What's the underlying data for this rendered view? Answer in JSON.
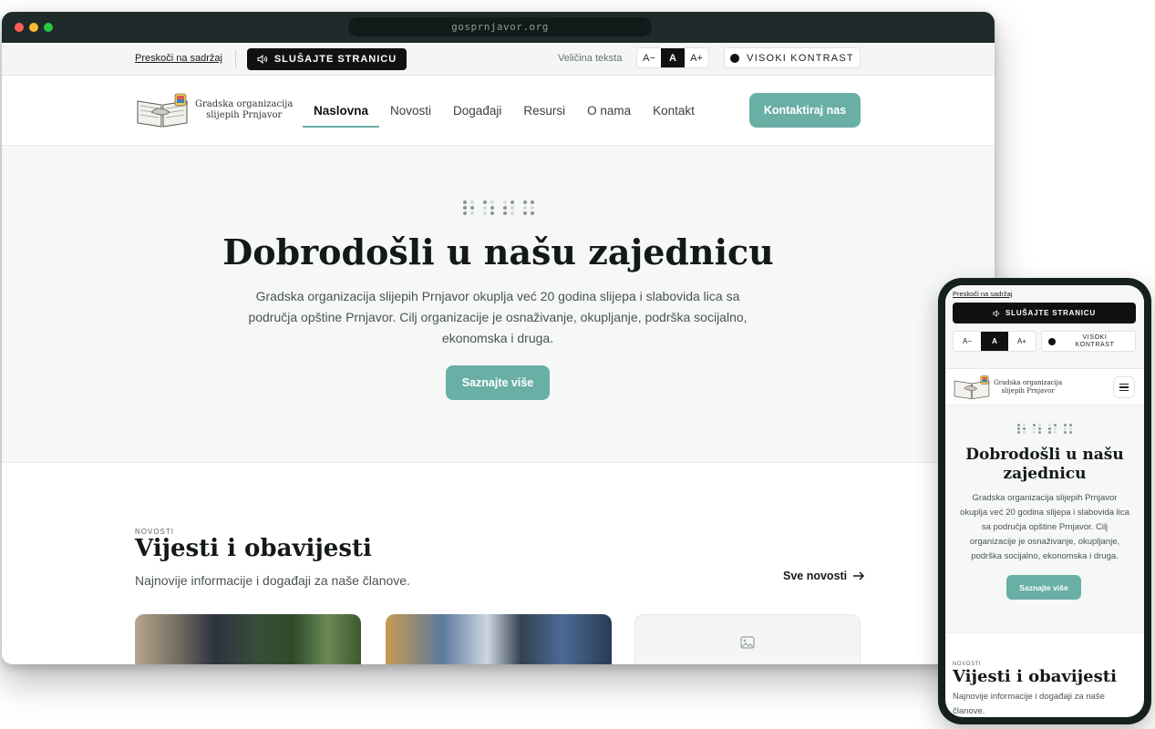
{
  "browser": {
    "url": "gosprnjavor.org"
  },
  "a11y": {
    "skip_link": "Preskoči na sadržaj",
    "listen_label": "SLUŠAJTE STRANICU",
    "text_size_label": "Veličina teksta",
    "text_size_options": [
      "A−",
      "A",
      "A+"
    ],
    "contrast_label": "VISOKI KONTRAST",
    "contrast_label_mobile_line1": "VISOKI",
    "contrast_label_mobile_line2": "KONTRAST"
  },
  "brand": {
    "line1": "Gradska organizacija",
    "line2": "slijepih Prnjavor"
  },
  "nav": {
    "items": [
      "Naslovna",
      "Novosti",
      "Događaji",
      "Resursi",
      "O nama",
      "Kontakt"
    ],
    "active": "Naslovna",
    "cta": "Kontaktiraj nas"
  },
  "hero": {
    "title": "Dobrodošli u našu zajednicu",
    "text": "Gradska organizacija slijepih Prnjavor okuplja već 20 godina slijepa i slabovida lica sa područja opštine Prnjavor. Cilj organizacije je osnaživanje, okupljanje, podrška socijalno, ekonomska i druga.",
    "button": "Saznajte više"
  },
  "news": {
    "eyebrow": "NOVOSTI",
    "title": "Vijesti i obavijesti",
    "subtitle": "Najnovije informacije i događaji za naše članove.",
    "all_link": "Sve novosti"
  },
  "icons": {
    "listen": "speaker-icon",
    "contrast": "contrast-dot-icon",
    "arrow": "arrow-right-icon",
    "placeholder": "image-placeholder-icon",
    "menu": "hamburger-icon"
  },
  "colors": {
    "accent": "#6aafa6",
    "dark": "#111111",
    "browser_chrome": "#1e2b2a"
  }
}
